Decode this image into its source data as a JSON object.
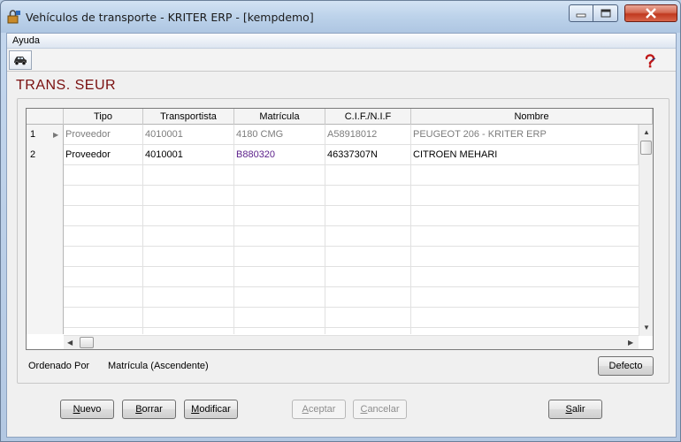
{
  "window": {
    "title": "Vehículos de transporte - KRITER ERP - [kempdemo]"
  },
  "menu": {
    "items": [
      {
        "label": "Ayuda"
      }
    ]
  },
  "toolbar": {
    "car_icon": "car-icon",
    "help_icon": "help-icon"
  },
  "form": {
    "title": "TRANS. SEUR"
  },
  "grid": {
    "columns": [
      "Tipo",
      "Transportista",
      "Matrícula",
      "C.I.F./N.I.F",
      "Nombre"
    ],
    "rows": [
      {
        "num": "1",
        "current": true,
        "tipo": "Proveedor",
        "transportista": "4010001",
        "matricula": "4180 CMG",
        "cif": "A58918012",
        "nombre": "PEUGEOT 206 - KRITER ERP"
      },
      {
        "num": "2",
        "current": false,
        "tipo": "Proveedor",
        "transportista": "4010001",
        "matricula": "B880320",
        "cif": "46337307N",
        "nombre": "CITROEN MEHARI"
      }
    ]
  },
  "sort": {
    "label": "Ordenado Por",
    "value": "Matrícula (Ascendente)"
  },
  "buttons": {
    "defecto": {
      "first": "",
      "accel": "",
      "rest": "Defecto"
    },
    "nuevo": {
      "first": "",
      "accel": "N",
      "rest": "uevo"
    },
    "borrar": {
      "first": "",
      "accel": "B",
      "rest": "orrar"
    },
    "modificar": {
      "first": "",
      "accel": "M",
      "rest": "odificar"
    },
    "aceptar": {
      "first": "",
      "accel": "A",
      "rest": "ceptar"
    },
    "cancelar": {
      "first": "",
      "accel": "C",
      "rest": "ancelar"
    },
    "salir": {
      "first": "",
      "accel": "S",
      "rest": "alir"
    }
  },
  "colors": {
    "title_red": "#7a1010",
    "matricula_purple": "#5b1f8a"
  }
}
